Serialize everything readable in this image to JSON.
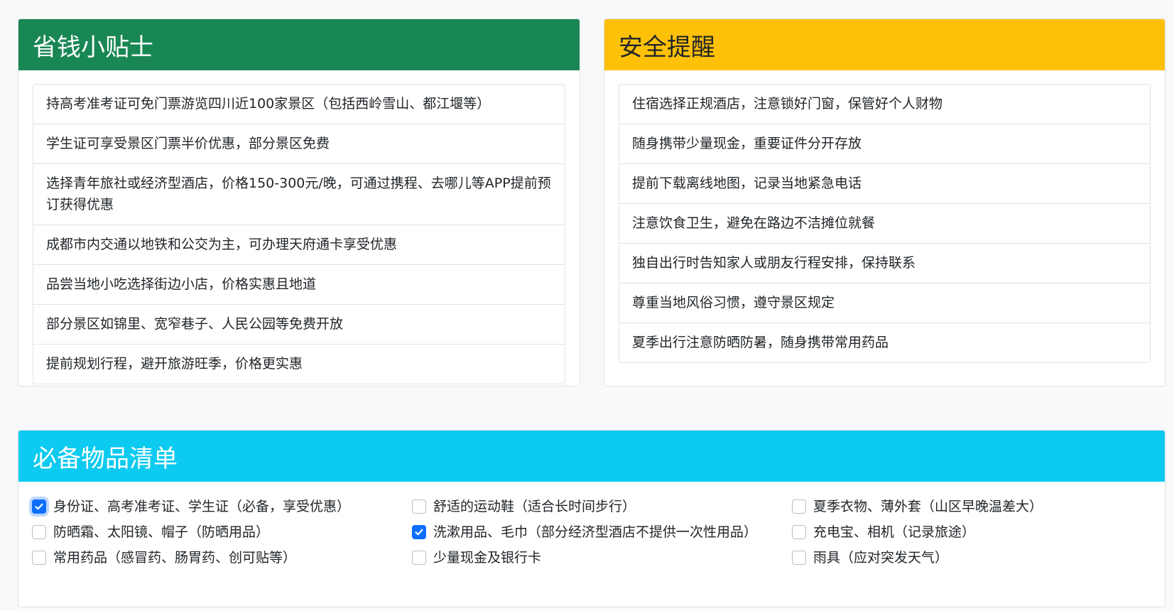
{
  "savings": {
    "title": "省钱小贴士",
    "header_color": "#198754",
    "items": [
      "持高考准考证可免门票游览四川近100家景区（包括西岭雪山、都江堰等）",
      "学生证可享受景区门票半价优惠，部分景区免费",
      "选择青年旅社或经济型酒店，价格150-300元/晚，可通过携程、去哪儿等APP提前预订获得优惠",
      "成都市内交通以地铁和公交为主，可办理天府通卡享受优惠",
      "品尝当地小吃选择街边小店，价格实惠且地道",
      "部分景区如锦里、宽窄巷子、人民公园等免费开放",
      "提前规划行程，避开旅游旺季，价格更实惠"
    ]
  },
  "safety": {
    "title": "安全提醒",
    "header_color": "#ffc107",
    "items": [
      "住宿选择正规酒店，注意锁好门窗，保管好个人财物",
      "随身携带少量现金，重要证件分开存放",
      "提前下载离线地图，记录当地紧急电话",
      "注意饮食卫生，避免在路边不洁摊位就餐",
      "独自出行时告知家人或朋友行程安排，保持联系",
      "尊重当地风俗习惯，遵守景区规定",
      "夏季出行注意防晒防暑，随身携带常用药品"
    ]
  },
  "packing": {
    "title": "必备物品清单",
    "header_color": "#0dcaf0",
    "items": [
      {
        "label": "身份证、高考准考证、学生证（必备，享受优惠）",
        "checked": true
      },
      {
        "label": "舒适的运动鞋（适合长时间步行）",
        "checked": false
      },
      {
        "label": "夏季衣物、薄外套（山区早晚温差大）",
        "checked": false
      },
      {
        "label": "防晒霜、太阳镜、帽子（防晒用品）",
        "checked": false
      },
      {
        "label": "洗漱用品、毛巾（部分经济型酒店不提供一次性用品）",
        "checked": true
      },
      {
        "label": "充电宝、相机（记录旅途）",
        "checked": false
      },
      {
        "label": "常用药品（感冒药、肠胃药、创可贴等）",
        "checked": false
      },
      {
        "label": "少量现金及银行卡",
        "checked": false
      },
      {
        "label": "雨具（应对突发天气）",
        "checked": false
      }
    ]
  }
}
